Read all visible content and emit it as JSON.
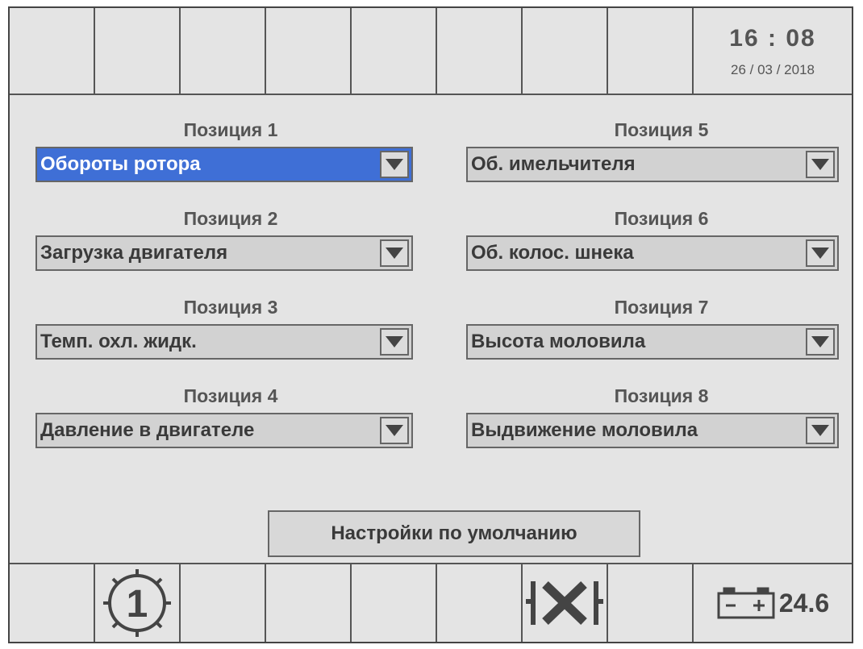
{
  "status": {
    "time": "16 : 08",
    "date": "26 / 03 / 2018"
  },
  "positions": [
    {
      "label": "Позиция 1",
      "value": "Обороты ротора",
      "selected": true
    },
    {
      "label": "Позиция 2",
      "value": "Загрузка двигателя",
      "selected": false
    },
    {
      "label": "Позиция 3",
      "value": "Темп. охл. жидк.",
      "selected": false
    },
    {
      "label": "Позиция 4",
      "value": "Давление в двигателе",
      "selected": false
    },
    {
      "label": "Позиция 5",
      "value": "Об. имельчителя",
      "selected": false
    },
    {
      "label": "Позиция 6",
      "value": "Об. колос. шнека",
      "selected": false
    },
    {
      "label": "Позиция 7",
      "value": "Высота моловила",
      "selected": false
    },
    {
      "label": "Позиция 8",
      "value": "Выдвижение моловила",
      "selected": false
    }
  ],
  "default_button": "Настройки по умолчанию",
  "bottom": {
    "gear_number": "1",
    "battery_voltage": "24.6"
  },
  "icons": {
    "gear": "gear-1-icon",
    "transmission": "transmission-x-icon",
    "battery": "battery-icon"
  },
  "colors": {
    "selected_dropdown": "#3f6fd6",
    "background": "#e4e4e4"
  }
}
